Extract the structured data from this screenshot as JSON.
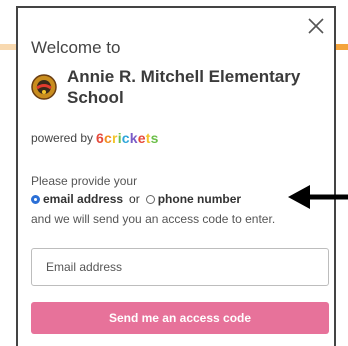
{
  "dialog": {
    "welcome": "Welcome to",
    "school_name": "Annie R. Mitchell Elementary School",
    "powered_by": "powered by",
    "brand": [
      "6",
      "c",
      "r",
      "i",
      "c",
      "k",
      "e",
      "t",
      "s"
    ],
    "prompt": "Please provide your",
    "option_email": "email address",
    "or_text": "or",
    "option_phone": "phone number",
    "follow_text": "and we will send you an access code to enter.",
    "email_placeholder": "Email address",
    "send_label": "Send me an access code"
  },
  "colors": {
    "send_button": "#e7729a",
    "radio_selected": "#2b6fd6"
  },
  "icons": {
    "close": "close-icon",
    "logo": "school-logo-icon",
    "arrow": "arrow-left-icon"
  },
  "state": {
    "selected_option": "email address"
  }
}
